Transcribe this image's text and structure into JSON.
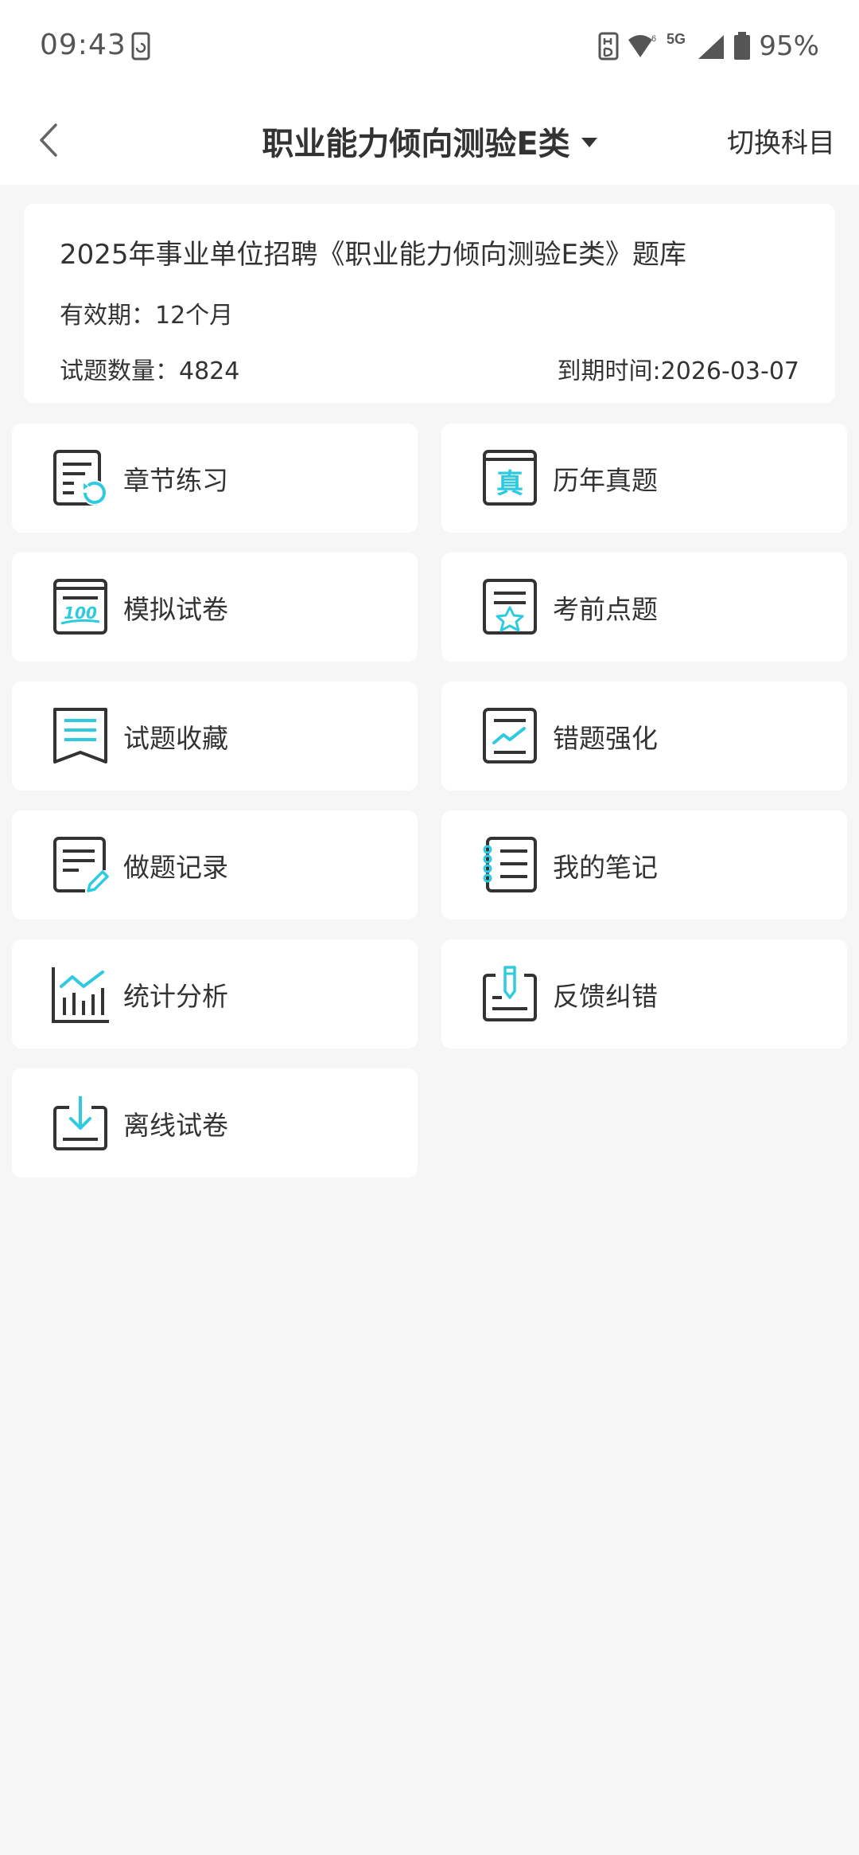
{
  "status_bar": {
    "time": "09:43",
    "network": "5G",
    "battery": "95%"
  },
  "header": {
    "title": "职业能力倾向测验E类",
    "switch_label": "切换科目"
  },
  "info": {
    "title": "2025年事业单位招聘《职业能力倾向测验E类》题库",
    "validity": "有效期：12个月",
    "count": "试题数量：4824",
    "expiry": "到期时间:2026-03-07"
  },
  "menu": {
    "items": [
      {
        "label": "章节练习",
        "icon": "chapter-practice-icon"
      },
      {
        "label": "历年真题",
        "icon": "past-exams-icon"
      },
      {
        "label": "模拟试卷",
        "icon": "mock-exam-icon"
      },
      {
        "label": "考前点题",
        "icon": "pre-exam-tips-icon"
      },
      {
        "label": "试题收藏",
        "icon": "favorites-icon"
      },
      {
        "label": "错题强化",
        "icon": "wrong-questions-icon"
      },
      {
        "label": "做题记录",
        "icon": "practice-record-icon"
      },
      {
        "label": "我的笔记",
        "icon": "notes-icon"
      },
      {
        "label": "统计分析",
        "icon": "statistics-icon"
      },
      {
        "label": "反馈纠错",
        "icon": "feedback-icon"
      },
      {
        "label": "离线试卷",
        "icon": "offline-download-icon"
      }
    ]
  },
  "colors": {
    "accent": "#2ecbe0",
    "icon_stroke": "#333333",
    "background": "#f6f6f6",
    "card": "#ffffff"
  }
}
